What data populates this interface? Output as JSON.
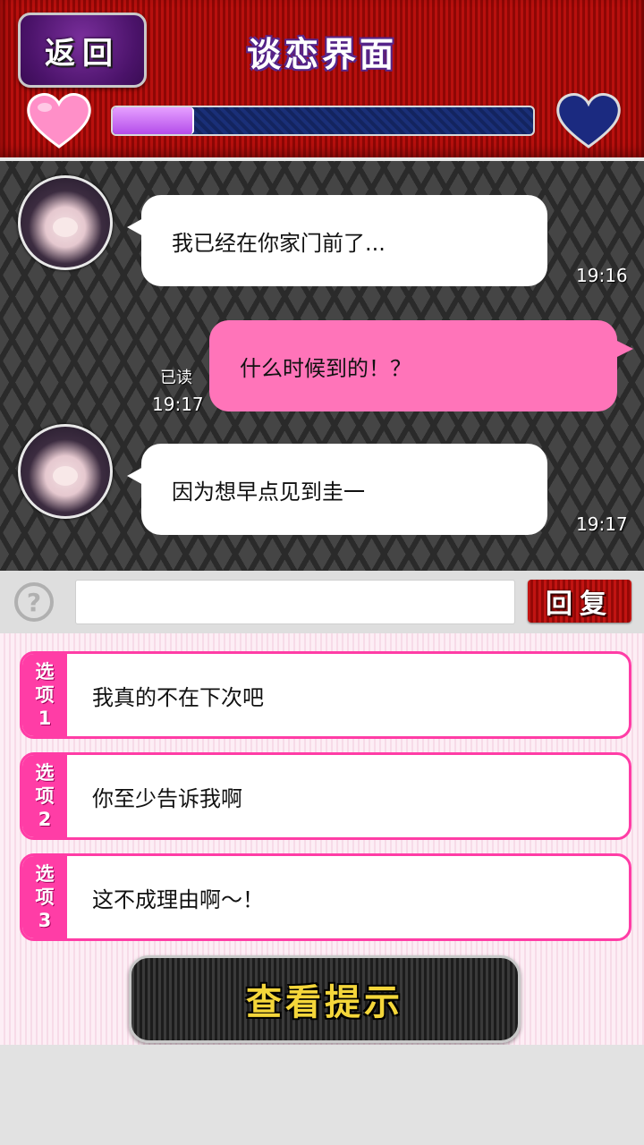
{
  "header": {
    "back_label": "返回",
    "title": "谈恋界面",
    "affection_progress": 0.19,
    "colors": {
      "heart_left": "#ff8fc8",
      "heart_right": "#1b2a80",
      "bar_fill": "#c070f2"
    }
  },
  "chat": {
    "messages": [
      {
        "from": "her",
        "text": "我已经在你家门前了...",
        "time": "19:16"
      },
      {
        "from": "me",
        "text": "什么时候到的！？",
        "status": "已读",
        "time": "19:17"
      },
      {
        "from": "her",
        "text": "因为想早点见到圭一",
        "time": "19:17"
      }
    ]
  },
  "input": {
    "help_symbol": "?",
    "value": "",
    "reply_label": "回复"
  },
  "options": [
    {
      "tag": [
        "选",
        "项",
        "1"
      ],
      "text": "我真的不在下次吧"
    },
    {
      "tag": [
        "选",
        "项",
        "2"
      ],
      "text": "你至少告诉我啊"
    },
    {
      "tag": [
        "选",
        "项",
        "3"
      ],
      "text": "这不成理由啊～！"
    }
  ],
  "hint_label": "查看提示"
}
